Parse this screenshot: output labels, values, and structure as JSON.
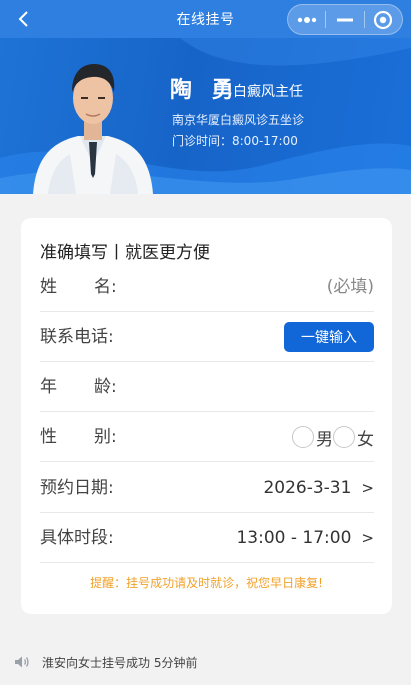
{
  "header": {
    "title": "在线挂号"
  },
  "doctor": {
    "name": "陶 勇",
    "title": "白癜风主任",
    "hospital": "南京华厦白癜风诊五坐诊",
    "hours": "门诊时间：8:00-17:00"
  },
  "form": {
    "heading": "准确填写丨就医更方便",
    "name": {
      "label_a": "姓",
      "label_b": "名:",
      "placeholder": "(必填)"
    },
    "phone": {
      "label": "联系电话:",
      "button": "一键输入"
    },
    "age": {
      "label_a": "年",
      "label_b": "龄:"
    },
    "gender": {
      "label_a": "性",
      "label_b": "别:",
      "options": [
        "男",
        "女"
      ]
    },
    "date": {
      "label": "预约日期:",
      "value": "2026-3-31",
      "arrow": ">"
    },
    "time": {
      "label": "具体时段:",
      "value": "13:00 - 17:00",
      "arrow": ">"
    },
    "reminder": "提醒：挂号成功请及时就诊，祝您早日康复!"
  },
  "notice": {
    "text": "淮安向女士挂号成功 5分钟前"
  },
  "colors": {
    "brand_blue": "#1166d8",
    "reminder_orange": "#f0a12a"
  }
}
